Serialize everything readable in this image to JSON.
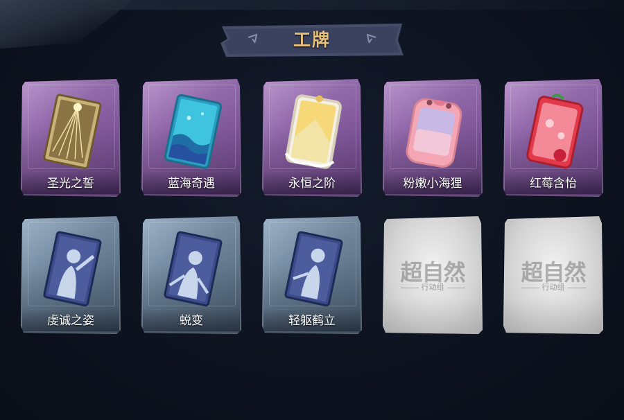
{
  "page": {
    "title": "工牌"
  },
  "cards": [
    {
      "name": "圣光之誓",
      "style": "purple",
      "art": "holy-light-card-icon"
    },
    {
      "name": "蓝海奇遇",
      "style": "purple",
      "art": "blue-sea-card-icon"
    },
    {
      "name": "永恒之阶",
      "style": "purple",
      "art": "eternal-step-card-icon"
    },
    {
      "name": "粉嫩小海狸",
      "style": "purple",
      "art": "pink-beaver-card-icon"
    },
    {
      "name": "红莓含怡",
      "style": "purple",
      "art": "red-berry-card-icon"
    },
    {
      "name": "虔诚之姿",
      "style": "blue",
      "art": "devout-pose-silhouette-icon"
    },
    {
      "name": "蜕变",
      "style": "blue",
      "art": "transformation-silhouette-icon"
    },
    {
      "name": "轻躯鹤立",
      "style": "blue",
      "art": "light-crane-silhouette-icon"
    },
    {
      "name": "",
      "style": "gray",
      "art": "locked-placeholder-icon",
      "placeholder_logo": "超自然",
      "placeholder_sub": "行动组"
    },
    {
      "name": "",
      "style": "gray",
      "art": "locked-placeholder-icon",
      "placeholder_logo": "超自然",
      "placeholder_sub": "行动组"
    }
  ],
  "colors": {
    "background": "#0d1320",
    "title": "#e8c07a",
    "purple_frame": "#8c62a6",
    "blue_frame": "#6d8399",
    "gray_frame": "#d4d4d4"
  }
}
